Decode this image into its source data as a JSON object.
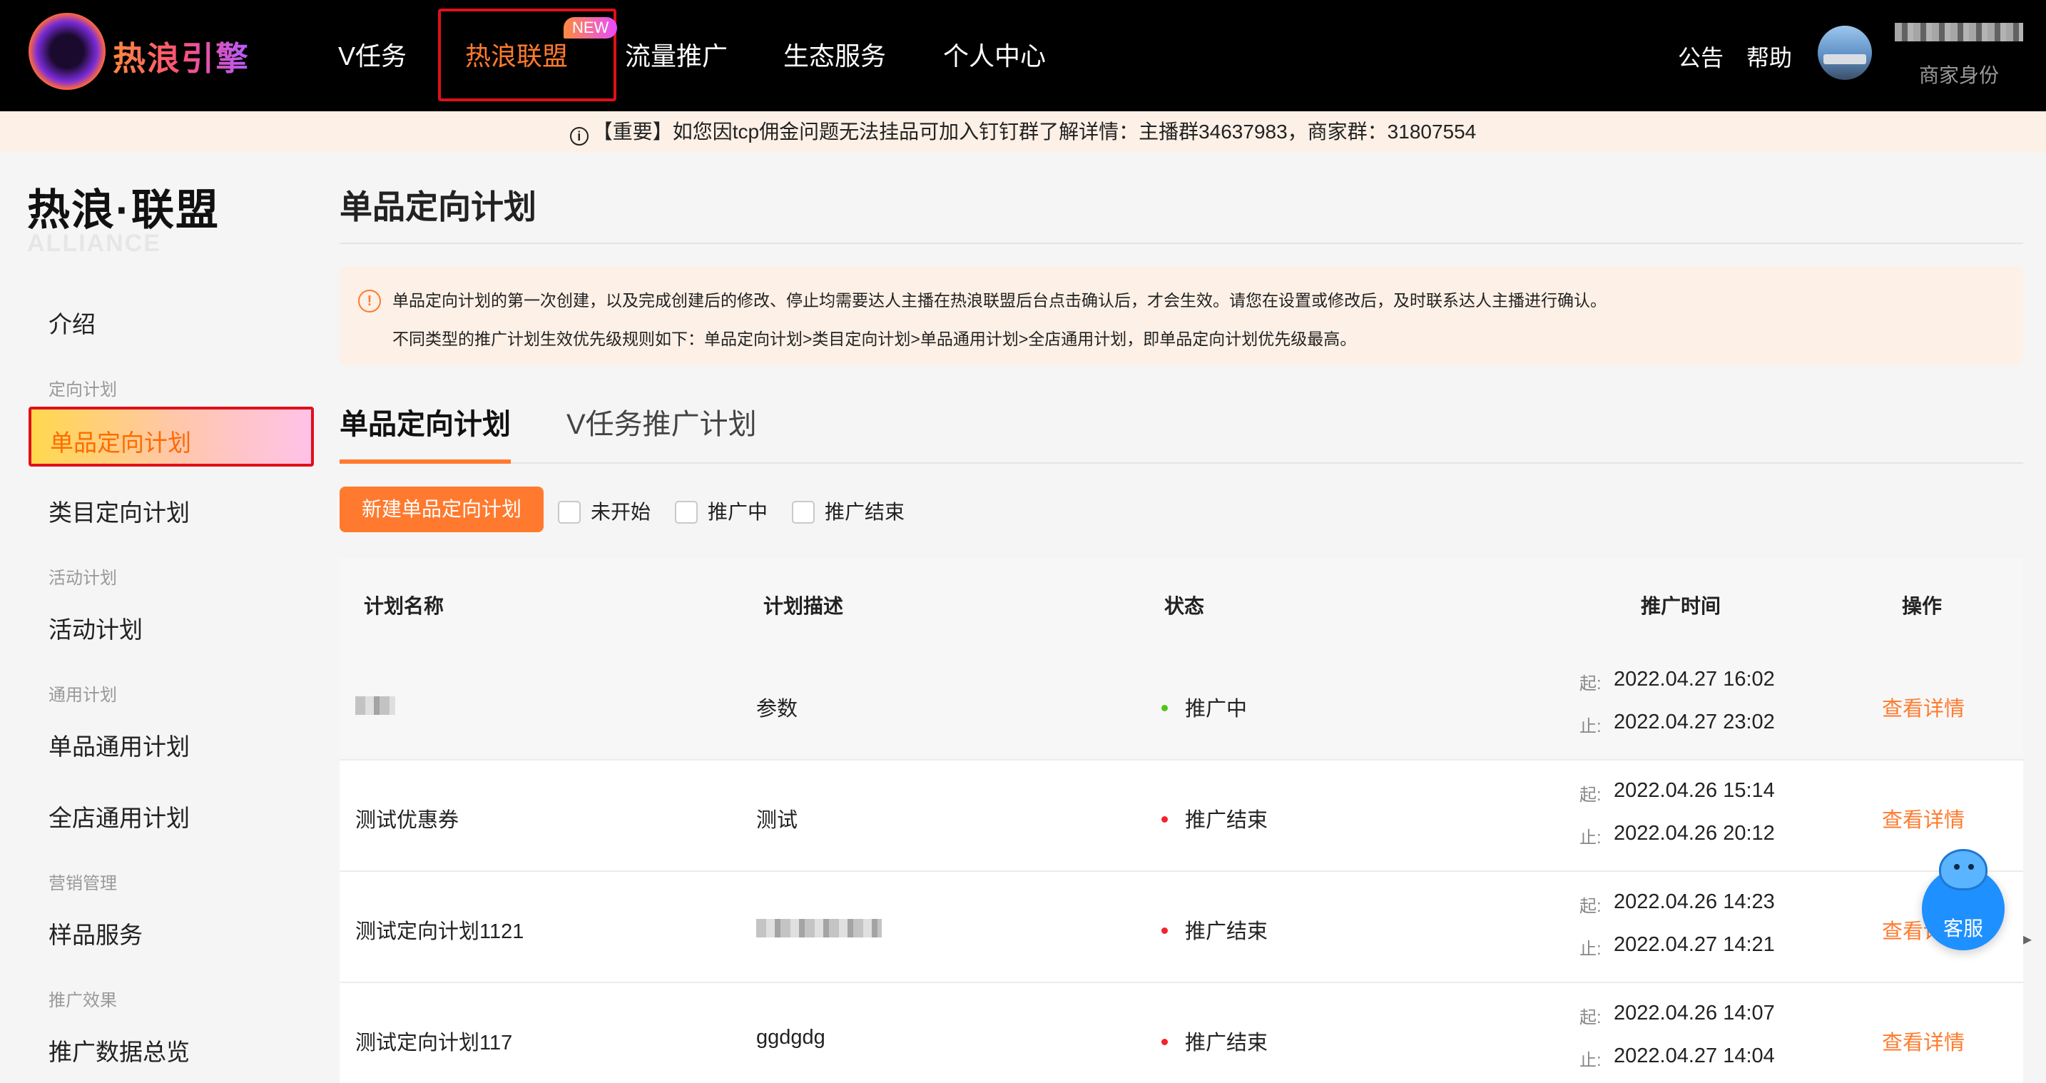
{
  "brand": {
    "logo_text": "热浪引擎"
  },
  "nav": {
    "items": [
      {
        "label": "V任务"
      },
      {
        "label": "热浪联盟",
        "badge": "NEW"
      },
      {
        "label": "流量推广"
      },
      {
        "label": "生态服务"
      },
      {
        "label": "个人中心"
      }
    ],
    "announcement": "公告",
    "help": "帮助",
    "user_role": "商家身份"
  },
  "notice": {
    "text": "【重要】如您因tcp佣金问题无法挂品可加入钉钉群了解详情：主播群34637983，商家群：31807554"
  },
  "sidebar": {
    "title": "热浪·联盟",
    "subtitle": "ALLIANCE",
    "intro": "介绍",
    "groups": [
      {
        "label": "定向计划",
        "items": [
          "单品定向计划",
          "类目定向计划"
        ]
      },
      {
        "label": "活动计划",
        "items": [
          "活动计划"
        ]
      },
      {
        "label": "通用计划",
        "items": [
          "单品通用计划",
          "全店通用计划"
        ]
      },
      {
        "label": "营销管理",
        "items": [
          "样品服务"
        ]
      },
      {
        "label": "推广效果",
        "items": [
          "推广数据总览"
        ]
      }
    ],
    "active_item": "单品定向计划"
  },
  "main": {
    "title": "单品定向计划",
    "tips": [
      "单品定向计划的第一次创建，以及完成创建后的修改、停止均需要达人主播在热浪联盟后台点击确认后，才会生效。请您在设置或修改后，及时联系达人主播进行确认。",
      "不同类型的推广计划生效优先级规则如下：单品定向计划>类目定向计划>单品通用计划>全店通用计划，即单品定向计划优先级最高。"
    ],
    "tabs": [
      "单品定向计划",
      "V任务推广计划"
    ],
    "new_button": "新建单品定向计划",
    "filters": [
      "未开始",
      "推广中",
      "推广结束"
    ]
  },
  "table": {
    "columns": [
      "计划名称",
      "计划描述",
      "状态",
      "推广时间",
      "操作"
    ],
    "start_label": "起:",
    "end_label": "止:",
    "rows": [
      {
        "name": "",
        "desc": "参数",
        "status": "推广中",
        "start": "2022.04.27 16:02",
        "end": "2022.04.27 23:02",
        "action": "查看详情"
      },
      {
        "name": "测试优惠券",
        "desc": "测试",
        "status": "推广结束",
        "start": "2022.04.26 15:14",
        "end": "2022.04.26 20:12",
        "action": "查看详情"
      },
      {
        "name": "测试定向计划1121",
        "desc": "",
        "status": "推广结束",
        "start": "2022.04.26 14:23",
        "end": "2022.04.27 14:21",
        "action": "查看详情"
      },
      {
        "name": "测试定向计划117",
        "desc": "ggdgdg",
        "status": "推广结束",
        "start": "2022.04.26 14:07",
        "end": "2022.04.27 14:04",
        "action": "查看详情"
      }
    ]
  },
  "colors": {
    "accent": "#ff7a2e",
    "status_active": "#52c41a",
    "status_ended": "#f5222d"
  },
  "customer_service": {
    "label": "客服"
  }
}
